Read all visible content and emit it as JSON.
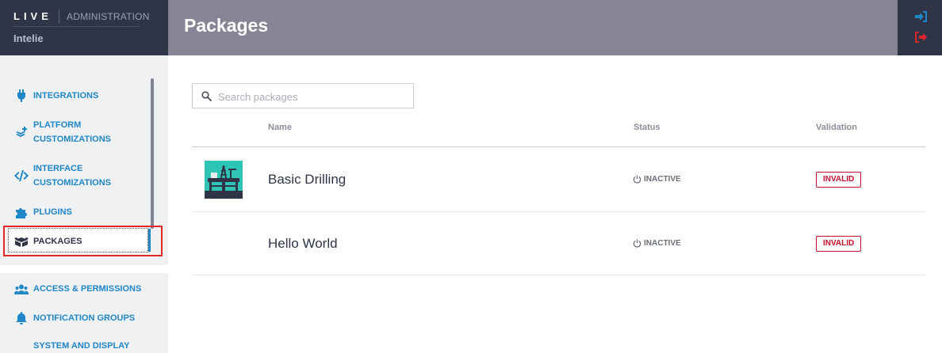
{
  "brand": {
    "logo": "LIVE",
    "section": "ADMINISTRATION",
    "org": "Intelie"
  },
  "header": {
    "title": "Packages"
  },
  "sidebar": {
    "items": [
      {
        "label": "INTEGRATIONS",
        "icon": "plug-icon"
      },
      {
        "label": "PLATFORM CUSTOMIZATIONS",
        "icon": "layers-plus-icon"
      },
      {
        "label": "INTERFACE CUSTOMIZATIONS",
        "icon": "code-icon"
      },
      {
        "label": "PLUGINS",
        "icon": "puzzle-icon"
      },
      {
        "label": "PACKAGES",
        "icon": "box-icon"
      },
      {
        "label": "ACCESS & PERMISSIONS",
        "icon": "users-icon"
      },
      {
        "label": "NOTIFICATION GROUPS",
        "icon": "bell-icon"
      },
      {
        "label": "SYSTEM AND DISPLAY",
        "icon": "system-icon"
      }
    ]
  },
  "search": {
    "placeholder": "Search packages",
    "value": ""
  },
  "table": {
    "columns": [
      "Name",
      "Status",
      "Validation"
    ],
    "rows": [
      {
        "name": "Basic Drilling",
        "status": "INACTIVE",
        "validation": "INVALID",
        "thumbnail": "drilling-rig-icon"
      },
      {
        "name": "Hello World",
        "status": "INACTIVE",
        "validation": "INVALID"
      }
    ]
  },
  "colors": {
    "sidebar_header": "#2f3447",
    "topbar": "#878496",
    "link_blue": "#1f86c8",
    "invalid_red": "#c8102e",
    "thumb_teal": "#2ec4b6",
    "highlight_red": "#e0262b"
  }
}
